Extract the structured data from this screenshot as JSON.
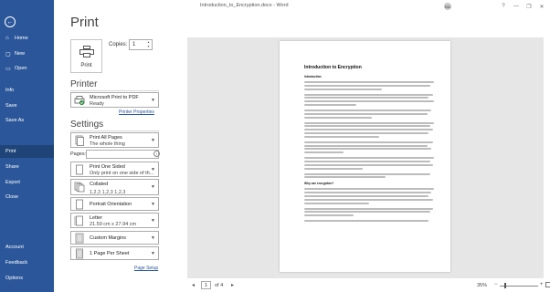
{
  "window": {
    "title": "Introduction_to_Encryption.docx  -  Word",
    "user_badge": "BM",
    "controls": {
      "help": "?",
      "minimize": "—",
      "restore": "❐",
      "close": "✕"
    }
  },
  "nav": {
    "back_icon": "back-arrow-icon",
    "items": [
      {
        "label": "Home",
        "icon": "home-icon",
        "glyph": "⌂"
      },
      {
        "label": "New",
        "icon": "new-document-icon",
        "glyph": "▢"
      },
      {
        "label": "Open",
        "icon": "open-folder-icon",
        "glyph": "▭"
      },
      {
        "label": "Info",
        "icon": "",
        "glyph": ""
      },
      {
        "label": "Save",
        "icon": "",
        "glyph": ""
      },
      {
        "label": "Save As",
        "icon": "",
        "glyph": ""
      },
      {
        "label": "Print",
        "icon": "",
        "glyph": ""
      },
      {
        "label": "Share",
        "icon": "",
        "glyph": ""
      },
      {
        "label": "Export",
        "icon": "",
        "glyph": ""
      },
      {
        "label": "Close",
        "icon": "",
        "glyph": ""
      },
      {
        "label": "Account",
        "icon": "",
        "glyph": ""
      },
      {
        "label": "Feedback",
        "icon": "",
        "glyph": ""
      },
      {
        "label": "Options",
        "icon": "",
        "glyph": ""
      }
    ],
    "active": "Print"
  },
  "print": {
    "heading": "Print",
    "print_button_label": "Print",
    "copies_label": "Copies:",
    "copies_value": "1"
  },
  "printer": {
    "heading": "Printer",
    "name": "Microsoft Print to PDF",
    "status": "Ready",
    "properties_link": "Printer Properties"
  },
  "settings": {
    "heading": "Settings",
    "range": {
      "title": "Print All Pages",
      "sub": "The whole thing"
    },
    "pages_label": "Pages:",
    "pages_value": "",
    "info_glyph": "i",
    "sides": {
      "title": "Print One Sided",
      "sub": "Only print on one side of th..."
    },
    "collate": {
      "title": "Collated",
      "sub": "1,2,3    1,2,3    1,2,3"
    },
    "orientation": {
      "title": "Portrait Orientation"
    },
    "paper": {
      "title": "Letter",
      "sub": "21.59 cm x 27.94 cm"
    },
    "margins": {
      "title": "Custom Margins"
    },
    "per_sheet": {
      "title": "1 Page Per Sheet"
    },
    "page_setup_link": "Page Setup"
  },
  "preview": {
    "doc_heading": "Introduction to Encryption",
    "sub_heading_1": "Introduction",
    "sub_heading_2": "Why use encryption?"
  },
  "status": {
    "prev": "◂",
    "page_current": "1",
    "page_of": "of 4",
    "next": "▸",
    "zoom": "35%",
    "zoom_minus": "−",
    "zoom_plus": "+",
    "zoom_level": 0.35
  },
  "colors": {
    "accent": "#2b579a",
    "accent_dark": "#1e4478",
    "preview_bg": "#e6e6e6"
  }
}
